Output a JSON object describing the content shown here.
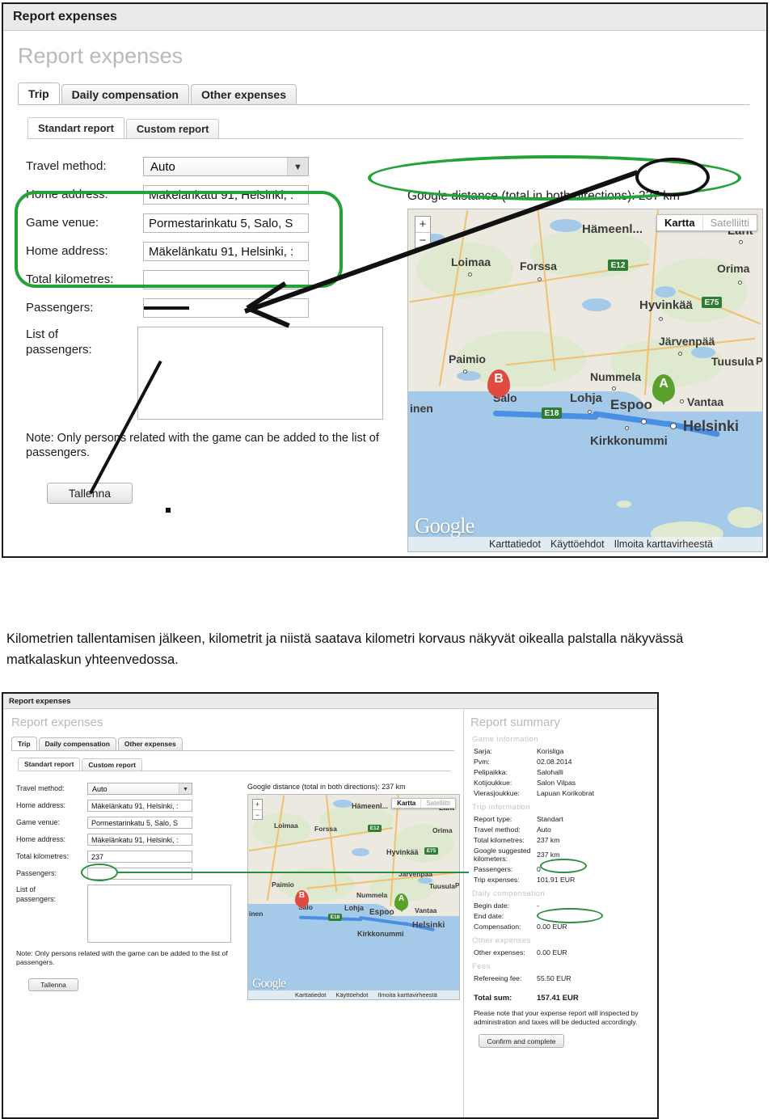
{
  "top_screenshot": {
    "window_title": "Report expenses",
    "page_title": "Report expenses",
    "tabs": [
      {
        "label": "Trip",
        "active": true
      },
      {
        "label": "Daily compensation",
        "active": false
      },
      {
        "label": "Other expenses",
        "active": false
      }
    ],
    "subtabs": [
      {
        "label": "Standart report",
        "active": true
      },
      {
        "label": "Custom report",
        "active": false
      }
    ],
    "form": {
      "travel_method_label": "Travel method:",
      "travel_method_value": "Auto",
      "home_address_label": "Home address:",
      "home_address_value": "Mäkelänkatu 91, Helsinki, :",
      "game_venue_label": "Game venue:",
      "game_venue_value": "Pormestarinkatu 5, Salo, S",
      "home_address2_label": "Home address:",
      "home_address2_value": "Mäkelänkatu 91, Helsinki, :",
      "total_km_label": "Total kilometres:",
      "total_km_value": "",
      "passengers_label": "Passengers:",
      "passengers_value": "",
      "list_passengers_label": "List of passengers:",
      "list_passengers_value": "",
      "note": "Note: Only persons related with the game can be added to the list of passengers.",
      "save_button": "Tallenna"
    },
    "map": {
      "distance_label": "Google distance (total in both directions): 237 km",
      "zoom_in": "+",
      "zoom_out": "−",
      "type_map": "Kartta",
      "type_satellite": "Satelliitti",
      "logo": "Google",
      "attribution": [
        "Karttatiedot",
        "Käyttöehdot",
        "Ilmoita karttavirheestä"
      ],
      "pin_a": "A",
      "pin_b": "B",
      "cities": [
        "Hämeenlinna",
        "Lahti",
        "Loimaa",
        "Forssa",
        "Orima",
        "Hyvinkää",
        "Paimio",
        "Salo",
        "Järvenpää",
        "Tuusula",
        "Nummela",
        "Lohja",
        "Espoo",
        "Vantaa",
        "Helsinki",
        "Kirkkonummi",
        "inen",
        "P"
      ],
      "road_shields": [
        "E12",
        "E75",
        "E18"
      ]
    }
  },
  "caption": {
    "text": "Kilometrien tallentamisen jälkeen, kilometrit ja niistä saatava kilometri korvaus näkyvät oikealla palstalla näkyvässä matkalaskun yhteenvedossa."
  },
  "bottom_screenshot": {
    "window_title": "Report expenses",
    "page_title": "Report expenses",
    "tabs": [
      {
        "label": "Trip",
        "active": true
      },
      {
        "label": "Daily compensation",
        "active": false
      },
      {
        "label": "Other expenses",
        "active": false
      }
    ],
    "subtabs": [
      {
        "label": "Standart report",
        "active": true
      },
      {
        "label": "Custom report",
        "active": false
      }
    ],
    "form": {
      "travel_method_label": "Travel method:",
      "travel_method_value": "Auto",
      "home_address_label": "Home address:",
      "home_address_value": "Mäkelänkatu 91, Helsinki, :",
      "game_venue_label": "Game venue:",
      "game_venue_value": "Pormestarinkatu 5, Salo, S",
      "home_address2_label": "Home address:",
      "home_address2_value": "Mäkelänkatu 91, Helsinki, :",
      "total_km_label": "Total kilometres:",
      "total_km_value": "237",
      "passengers_label": "Passengers:",
      "passengers_value": "",
      "list_passengers_label": "List of passengers:",
      "list_passengers_value": "",
      "note": "Note: Only persons related with the game can be added to the list of passengers.",
      "save_button": "Tallenna"
    },
    "map": {
      "distance_label": "Google distance (total in both directions): 237 km",
      "zoom_in": "+",
      "zoom_out": "−",
      "type_map": "Kartta",
      "type_satellite": "Satelliitti",
      "logo": "Google",
      "attribution": [
        "Karttatiedot",
        "Käyttöehdot",
        "Ilmoita karttavirheestä"
      ],
      "pin_a": "A",
      "pin_b": "B"
    },
    "summary": {
      "title": "Report summary",
      "sections": [
        {
          "heading": "Game information",
          "rows": [
            {
              "key": "Sarja:",
              "value": "Korisliga"
            },
            {
              "key": "Pvm:",
              "value": "02.08.2014"
            },
            {
              "key": "Pelipaikka:",
              "value": "Salohalli"
            },
            {
              "key": "Kotijoukkue:",
              "value": "Salon Vilpas"
            },
            {
              "key": "Vierasjoukkue:",
              "value": "Lapuan Korikobrat"
            }
          ]
        },
        {
          "heading": "Trip information",
          "rows": [
            {
              "key": "Report type:",
              "value": "Standart"
            },
            {
              "key": "Travel method:",
              "value": "Auto"
            },
            {
              "key": "Total kilometres:",
              "value": "237 km",
              "highlight": true
            },
            {
              "key": "Google suggested kilometers:",
              "value": "237 km"
            },
            {
              "key": "Passengers:",
              "value": "0"
            },
            {
              "key": "Trip expenses:",
              "value": "101.91 EUR",
              "highlight": true
            }
          ]
        },
        {
          "heading": "Daily compensation",
          "rows": [
            {
              "key": "Begin date:",
              "value": "-"
            },
            {
              "key": "End date:",
              "value": "-"
            },
            {
              "key": "Compensation:",
              "value": "0.00 EUR"
            }
          ]
        },
        {
          "heading": "Other expenses",
          "rows": [
            {
              "key": "Other expenses:",
              "value": "0.00 EUR"
            }
          ]
        },
        {
          "heading": "Fees",
          "rows": [
            {
              "key": "Refereeing fee:",
              "value": "55.50 EUR"
            }
          ]
        }
      ],
      "total_key": "Total sum:",
      "total_value": "157.41 EUR",
      "note": "Please note that your expense report will inspected by administration and taxes will be deducted accordingly.",
      "confirm_button": "Confirm and complete"
    }
  },
  "colors": {
    "annotation_green": "#21a338",
    "annotation_black": "#111111",
    "map_water": "#a5c9e8",
    "map_land": "#ece9e0",
    "route_blue": "#4a90e2",
    "pin_a_green": "#5aa02c",
    "pin_b_red": "#e04a3f"
  }
}
